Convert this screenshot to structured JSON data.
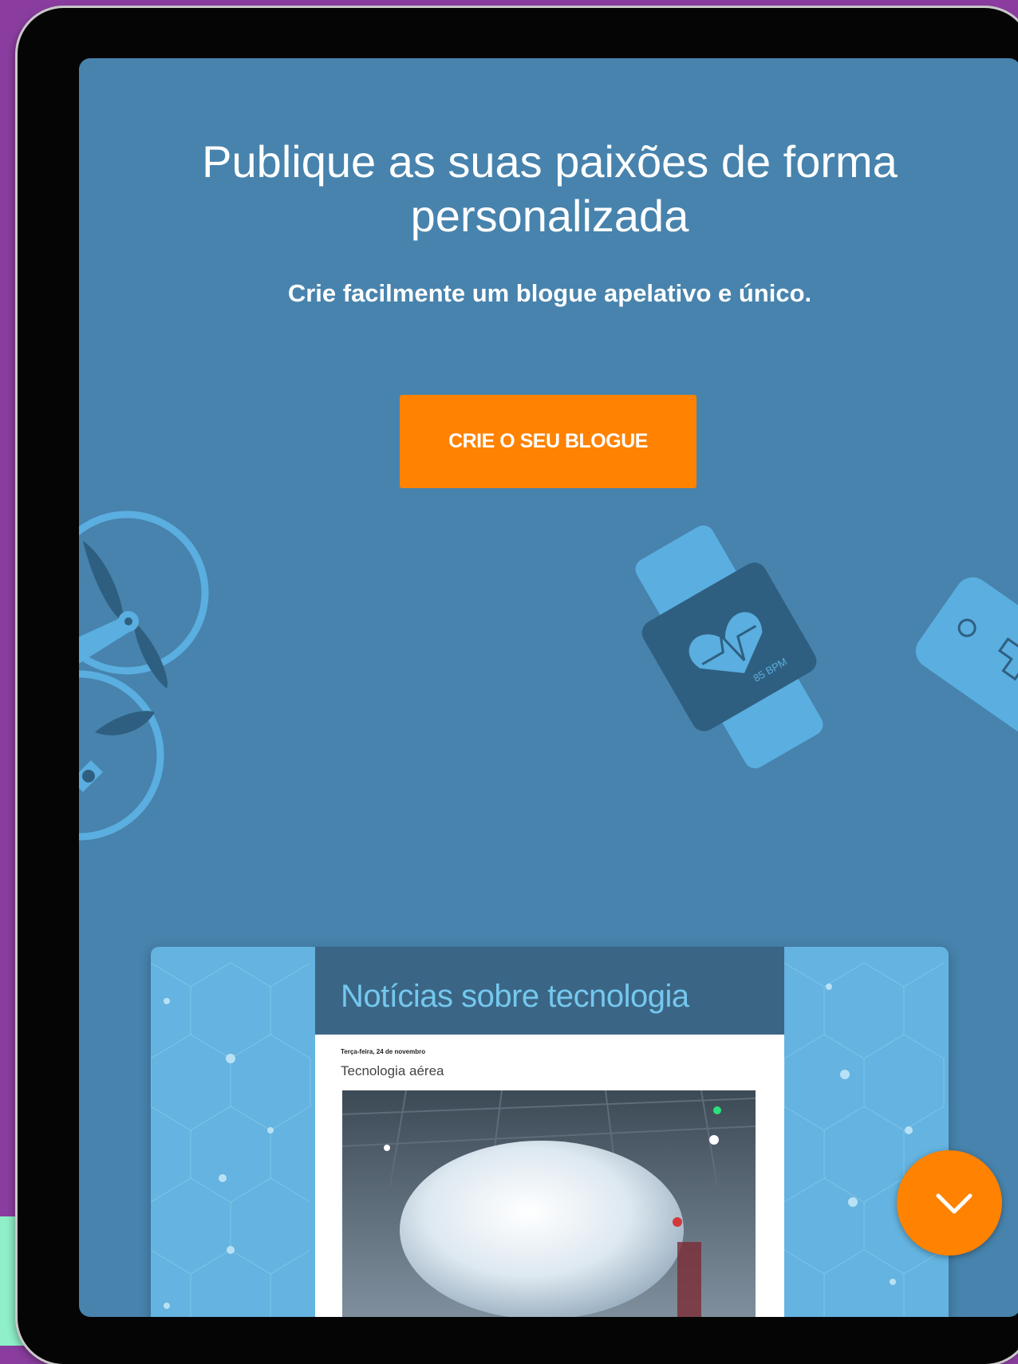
{
  "hero": {
    "title": "Publique as suas paixões de forma personalizada",
    "subtitle": "Crie facilmente um blogue apelativo e único.",
    "cta_label": "CRIE O SEU BLOGUE"
  },
  "watch": {
    "bpm_label": "85 BPM"
  },
  "preview": {
    "blog_title": "Notícias sobre tecnologia",
    "post_date": "Terça-feira, 24 de novembro",
    "post_title": "Tecnologia aérea"
  },
  "icons": {
    "scroll_down": "chevron-down-icon",
    "drone": "drone-illustration",
    "watch": "smartwatch-illustration",
    "gamepad": "gamepad-illustration"
  },
  "colors": {
    "hero_bg": "#4783ad",
    "cta": "#ff8200",
    "outer_bg": "#8a3d9e",
    "illustration": "#5aaee0",
    "preview_pattern": "#64b3e0",
    "blog_header": "#3b6585",
    "blog_title": "#74c8ee"
  }
}
